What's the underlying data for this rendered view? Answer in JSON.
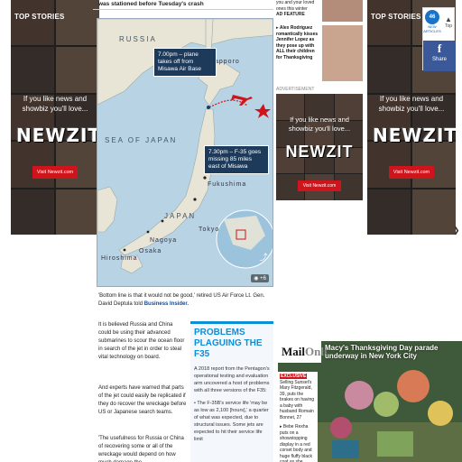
{
  "side_ad": {
    "top_stories": "TOP STORIES",
    "tease": "If you like news and showbiz you'll love...",
    "logo": "NEWZIT",
    "cta": "Visit Newzit.com"
  },
  "article": {
    "caption_top": "was stationed before Tuesday's crash",
    "map": {
      "russia": "RUSSIA",
      "sea_of_japan": "SEA OF JAPAN",
      "japan": "JAPAN",
      "sapporo": "apporo",
      "fukushima": "Fukushima",
      "tokyo": "Tokyo",
      "nagoya": "Nagoya",
      "osaka": "Osaka",
      "hiroshima": "Hiroshima",
      "callout_1": "7.00pm – plane takes off from Misawa Air Base",
      "callout_2": "7.30pm – F-35 goes missing 85 miles east of Misawa",
      "photo_count": "+6"
    },
    "para_1": "'Bottom line is that it would not be good,' retired US Air Force Lt. Gen. David Deptula told",
    "para_1_link": "Business Insider.",
    "para_2": "It is believed Russia and China could be using their advanced submarines to scour the ocean floor in search of the jet in order to steal vital technology on board.",
    "para_3": "And experts have warned that parts of the jet could easily be replicated if they do recover the wreckage before US or Japanese search teams.",
    "para_4": "'The usefulness for Russia or China of recovering some or all of the wreckage would depend on how much damage the"
  },
  "sidebar_box": {
    "title": "PROBLEMS PLAGUING THE F35",
    "body_1": "A 2018 report from the Pentagon's operational testing and evaluation arm uncovered a host of problems with all three versions of the F35:",
    "body_2": "• The F-35B's service life 'may be as low as 2,100 [hours],' a quarter of what was expected, due to structural issues. Some jets are expected to hit their service life limit"
  },
  "right_col": {
    "story_top": "you and your loved ones this winter",
    "ad_feature": "AD FEATURE",
    "story_2": "Alex Rodriguez romantically kisses Jennifer Lopez as they pose up with ALL their children for Thanksgiving",
    "advertisement": "ADVERTISEMENT",
    "mid_tease": "If you like news and showbiz you'll love...",
    "mid_logo": "NEWZIT",
    "mid_cta": "Visit Newzit.com"
  },
  "share": {
    "new_articles_count": "46",
    "new_articles": "NEW ARTICLES",
    "top": "Top",
    "fb_letter": "f",
    "share": "Share"
  },
  "video": {
    "logo_main": "Mail",
    "logo_rest": "Onli",
    "title": "Macy's Thanksgiving Day parade underway in New York City",
    "exclusive": "EXCLUSIVE",
    "story_1": "Selling Sunset's Mary Fitzgerald, 39, puts the brakes on having a baby with husband Romain Bonnet, 27",
    "story_2": "Bebe Rexha puts on a showstopping display in a red corset body and huge fluffy black coat as she performs at the"
  },
  "colors": {
    "accent_blue": "#0c8fd6",
    "newzit_red": "#d0141b",
    "facebook_blue": "#3b5998",
    "callout_navy": "#1e3a5a"
  }
}
